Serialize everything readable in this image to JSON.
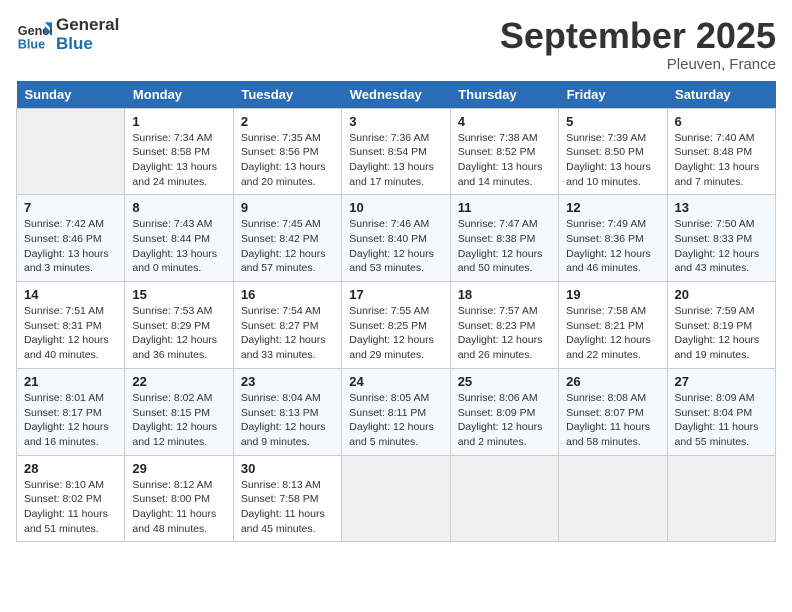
{
  "header": {
    "logo_line1": "General",
    "logo_line2": "Blue",
    "month": "September 2025",
    "location": "Pleuven, France"
  },
  "days_of_week": [
    "Sunday",
    "Monday",
    "Tuesday",
    "Wednesday",
    "Thursday",
    "Friday",
    "Saturday"
  ],
  "weeks": [
    [
      {
        "num": "",
        "info": ""
      },
      {
        "num": "1",
        "info": "Sunrise: 7:34 AM\nSunset: 8:58 PM\nDaylight: 13 hours and 24 minutes."
      },
      {
        "num": "2",
        "info": "Sunrise: 7:35 AM\nSunset: 8:56 PM\nDaylight: 13 hours and 20 minutes."
      },
      {
        "num": "3",
        "info": "Sunrise: 7:36 AM\nSunset: 8:54 PM\nDaylight: 13 hours and 17 minutes."
      },
      {
        "num": "4",
        "info": "Sunrise: 7:38 AM\nSunset: 8:52 PM\nDaylight: 13 hours and 14 minutes."
      },
      {
        "num": "5",
        "info": "Sunrise: 7:39 AM\nSunset: 8:50 PM\nDaylight: 13 hours and 10 minutes."
      },
      {
        "num": "6",
        "info": "Sunrise: 7:40 AM\nSunset: 8:48 PM\nDaylight: 13 hours and 7 minutes."
      }
    ],
    [
      {
        "num": "7",
        "info": "Sunrise: 7:42 AM\nSunset: 8:46 PM\nDaylight: 13 hours and 3 minutes."
      },
      {
        "num": "8",
        "info": "Sunrise: 7:43 AM\nSunset: 8:44 PM\nDaylight: 13 hours and 0 minutes."
      },
      {
        "num": "9",
        "info": "Sunrise: 7:45 AM\nSunset: 8:42 PM\nDaylight: 12 hours and 57 minutes."
      },
      {
        "num": "10",
        "info": "Sunrise: 7:46 AM\nSunset: 8:40 PM\nDaylight: 12 hours and 53 minutes."
      },
      {
        "num": "11",
        "info": "Sunrise: 7:47 AM\nSunset: 8:38 PM\nDaylight: 12 hours and 50 minutes."
      },
      {
        "num": "12",
        "info": "Sunrise: 7:49 AM\nSunset: 8:36 PM\nDaylight: 12 hours and 46 minutes."
      },
      {
        "num": "13",
        "info": "Sunrise: 7:50 AM\nSunset: 8:33 PM\nDaylight: 12 hours and 43 minutes."
      }
    ],
    [
      {
        "num": "14",
        "info": "Sunrise: 7:51 AM\nSunset: 8:31 PM\nDaylight: 12 hours and 40 minutes."
      },
      {
        "num": "15",
        "info": "Sunrise: 7:53 AM\nSunset: 8:29 PM\nDaylight: 12 hours and 36 minutes."
      },
      {
        "num": "16",
        "info": "Sunrise: 7:54 AM\nSunset: 8:27 PM\nDaylight: 12 hours and 33 minutes."
      },
      {
        "num": "17",
        "info": "Sunrise: 7:55 AM\nSunset: 8:25 PM\nDaylight: 12 hours and 29 minutes."
      },
      {
        "num": "18",
        "info": "Sunrise: 7:57 AM\nSunset: 8:23 PM\nDaylight: 12 hours and 26 minutes."
      },
      {
        "num": "19",
        "info": "Sunrise: 7:58 AM\nSunset: 8:21 PM\nDaylight: 12 hours and 22 minutes."
      },
      {
        "num": "20",
        "info": "Sunrise: 7:59 AM\nSunset: 8:19 PM\nDaylight: 12 hours and 19 minutes."
      }
    ],
    [
      {
        "num": "21",
        "info": "Sunrise: 8:01 AM\nSunset: 8:17 PM\nDaylight: 12 hours and 16 minutes."
      },
      {
        "num": "22",
        "info": "Sunrise: 8:02 AM\nSunset: 8:15 PM\nDaylight: 12 hours and 12 minutes."
      },
      {
        "num": "23",
        "info": "Sunrise: 8:04 AM\nSunset: 8:13 PM\nDaylight: 12 hours and 9 minutes."
      },
      {
        "num": "24",
        "info": "Sunrise: 8:05 AM\nSunset: 8:11 PM\nDaylight: 12 hours and 5 minutes."
      },
      {
        "num": "25",
        "info": "Sunrise: 8:06 AM\nSunset: 8:09 PM\nDaylight: 12 hours and 2 minutes."
      },
      {
        "num": "26",
        "info": "Sunrise: 8:08 AM\nSunset: 8:07 PM\nDaylight: 11 hours and 58 minutes."
      },
      {
        "num": "27",
        "info": "Sunrise: 8:09 AM\nSunset: 8:04 PM\nDaylight: 11 hours and 55 minutes."
      }
    ],
    [
      {
        "num": "28",
        "info": "Sunrise: 8:10 AM\nSunset: 8:02 PM\nDaylight: 11 hours and 51 minutes."
      },
      {
        "num": "29",
        "info": "Sunrise: 8:12 AM\nSunset: 8:00 PM\nDaylight: 11 hours and 48 minutes."
      },
      {
        "num": "30",
        "info": "Sunrise: 8:13 AM\nSunset: 7:58 PM\nDaylight: 11 hours and 45 minutes."
      },
      {
        "num": "",
        "info": ""
      },
      {
        "num": "",
        "info": ""
      },
      {
        "num": "",
        "info": ""
      },
      {
        "num": "",
        "info": ""
      }
    ]
  ]
}
